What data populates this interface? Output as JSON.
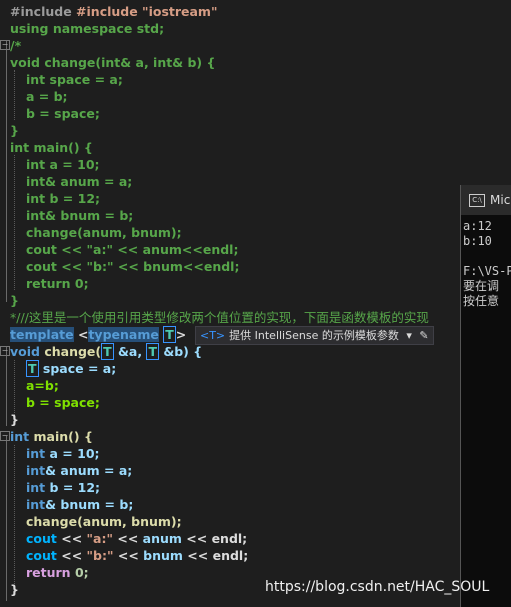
{
  "editor": {
    "top_lines": [
      "#include \"iostream\"",
      "using namespace std;",
      "/*",
      "void change(int& a, int& b) {",
      "int space = a;",
      "a = b;",
      "b = space;",
      "}",
      "int main() {",
      "int a = 10;",
      "int& anum = a;",
      "int b = 12;",
      "int& bnum = b;",
      "change(anum, bnum);",
      "cout << \"a:\" << anum<<endl;",
      "cout << \"b:\" << bnum<<endl;",
      "return 0;",
      "}",
      "*///这里是一个使用引用类型修改两个值位置的实现，下面是函数模板的实现"
    ],
    "template_line": {
      "kw1": "template",
      "lt": "<",
      "kw2": "typename",
      "tparam": "T",
      "gt": ">"
    },
    "tooltip": {
      "tag": "<T>",
      "text": "提供 IntelliSense 的示例模板参数",
      "dropdown": "▾",
      "edit": "✎"
    },
    "bottom": {
      "sig_void": "void",
      "sig_name": "change(",
      "sig_t1": "T",
      "sig_a": " &a, ",
      "sig_t2": "T",
      "sig_b": " &b) {",
      "l_space_t": "T",
      "l_space": " space = a;",
      "l_ab": "a=b;",
      "l_bspace": "b = space;",
      "close1": "}",
      "main_int": "int",
      "main_rest": " main() {",
      "l1_int": "int",
      "l1_rest": " a = 10;",
      "l2_int": "int",
      "l2_rest": "& anum = a;",
      "l3_int": "int",
      "l3_rest": " b = 12;",
      "l4_int": "int",
      "l4_rest": "& bnum = b;",
      "l5": "change(anum, bnum);",
      "l6_cout": "cout",
      "l6_op": " << ",
      "l6_str": "\"a:\"",
      "l6_op2": " << ",
      "l6_id": "anum",
      "l6_end": " << endl;",
      "l7_cout": "cout",
      "l7_op": " << ",
      "l7_str": "\"b:\"",
      "l7_op2": " << ",
      "l7_id": "bnum",
      "l7_end": " << endl;",
      "l8_ret": "return",
      "l8_rest": " 0;",
      "close2": "}"
    }
  },
  "console": {
    "title": "Mic",
    "icon": "C:\\",
    "lines": [
      "a:12",
      "b:10",
      "",
      "F:\\VS-P",
      "要在调",
      "按任意"
    ]
  },
  "watermark": "https://blog.csdn.net/HAC_SOUL"
}
